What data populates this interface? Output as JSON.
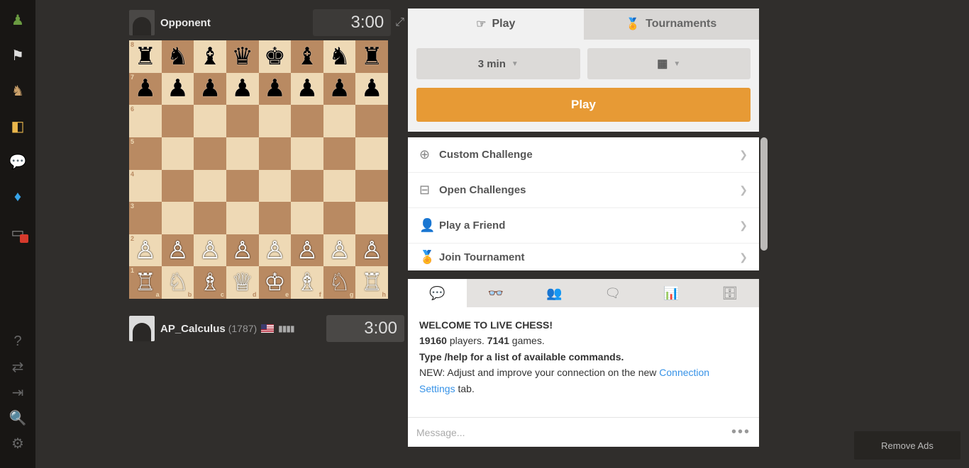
{
  "sidebar": {
    "top_icons": [
      "pawn-icon",
      "flag-icon",
      "knight-icon",
      "puzzle-icon",
      "chat-icon",
      "diamond-icon",
      "alert-icon"
    ],
    "bottom_icons": [
      "help-icon",
      "retweet-icon",
      "collapse-icon",
      "search-icon",
      "settings-icon"
    ]
  },
  "opponent": {
    "name": "Opponent",
    "clock": "3:00"
  },
  "player": {
    "name": "AP_Calculus",
    "rating": "(1787)",
    "clock": "3:00"
  },
  "board": {
    "ranks": [
      "8",
      "7",
      "6",
      "5",
      "4",
      "3",
      "2",
      "1"
    ],
    "files": [
      "a",
      "b",
      "c",
      "d",
      "e",
      "f",
      "g",
      "h"
    ],
    "position": [
      [
        "r",
        "n",
        "b",
        "q",
        "k",
        "b",
        "n",
        "r"
      ],
      [
        "p",
        "p",
        "p",
        "p",
        "p",
        "p",
        "p",
        "p"
      ],
      [
        "",
        "",
        "",
        "",
        "",
        "",
        "",
        ""
      ],
      [
        "",
        "",
        "",
        "",
        "",
        "",
        "",
        ""
      ],
      [
        "",
        "",
        "",
        "",
        "",
        "",
        "",
        ""
      ],
      [
        "",
        "",
        "",
        "",
        "",
        "",
        "",
        ""
      ],
      [
        "P",
        "P",
        "P",
        "P",
        "P",
        "P",
        "P",
        "P"
      ],
      [
        "R",
        "N",
        "B",
        "Q",
        "K",
        "B",
        "N",
        "R"
      ]
    ]
  },
  "right": {
    "tab_play": "Play",
    "tab_tournaments": "Tournaments",
    "time_dropdown": "3 min",
    "play_button": "Play",
    "options": [
      {
        "label": "Custom Challenge"
      },
      {
        "label": "Open Challenges"
      },
      {
        "label": "Play a Friend"
      },
      {
        "label": "Join Tournament"
      }
    ]
  },
  "chat": {
    "welcome": "WELCOME TO LIVE CHESS!",
    "players_count": "19160",
    "players_label": " players. ",
    "games_count": "7141",
    "games_label": " games.",
    "help_line": "Type /help for a list of available commands.",
    "new_prefix": "NEW: Adjust and improve your connection on the new ",
    "link_text": "Connection Settings",
    "new_suffix": " tab.",
    "placeholder": "Message..."
  },
  "footer": {
    "remove_ads": "Remove Ads"
  }
}
